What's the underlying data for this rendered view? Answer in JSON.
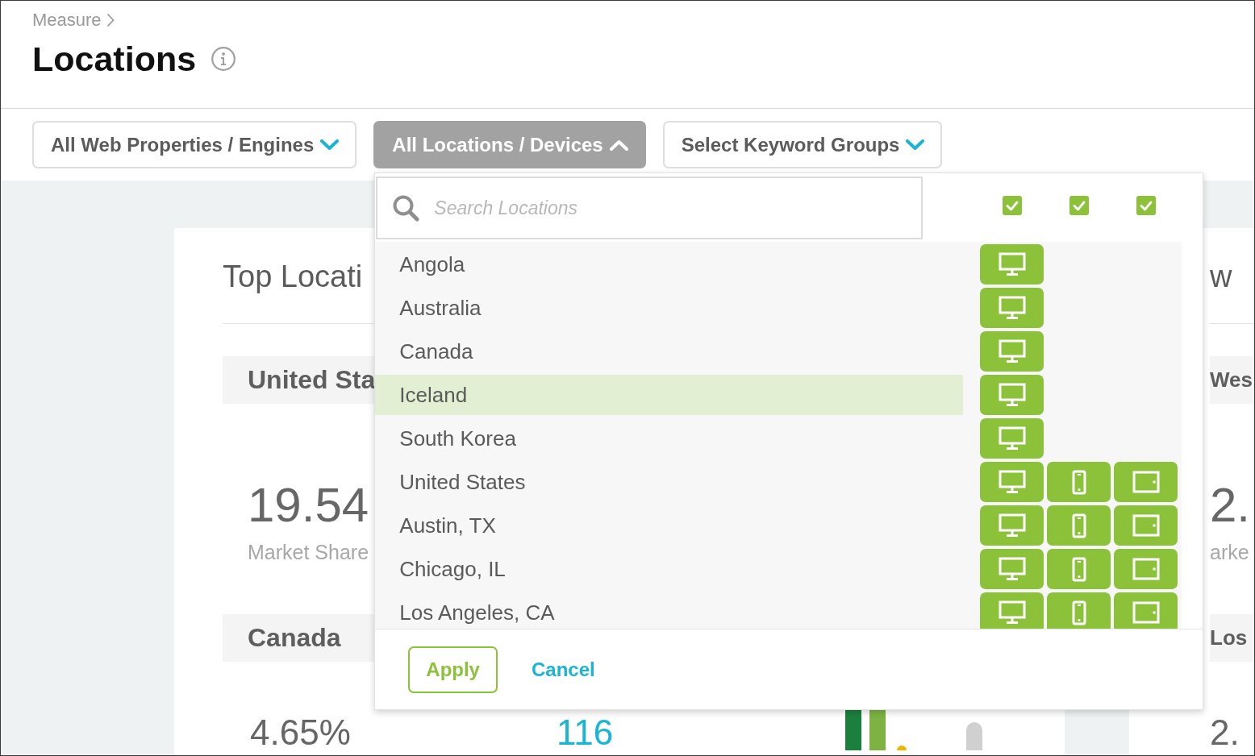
{
  "breadcrumb": {
    "label": "Measure"
  },
  "page": {
    "title": "Locations"
  },
  "filters": [
    {
      "label": "All Web Properties / Engines",
      "expanded": false
    },
    {
      "label": "All Locations / Devices",
      "expanded": true
    },
    {
      "label": "Select Keyword Groups",
      "expanded": false
    }
  ],
  "location_menu": {
    "search": {
      "placeholder": "Search Locations"
    },
    "device_columns": [
      {
        "checked": true
      },
      {
        "checked": true
      },
      {
        "checked": true
      }
    ],
    "locations": [
      {
        "name": "Angola",
        "selected": false,
        "devices": [
          {
            "kind": "desktop",
            "on": true
          }
        ]
      },
      {
        "name": "Australia",
        "selected": false,
        "devices": [
          {
            "kind": "desktop",
            "on": true
          }
        ]
      },
      {
        "name": "Canada",
        "selected": false,
        "devices": [
          {
            "kind": "desktop",
            "on": true
          }
        ]
      },
      {
        "name": "Iceland",
        "selected": true,
        "devices": [
          {
            "kind": "desktop",
            "on": true
          }
        ]
      },
      {
        "name": "South Korea",
        "selected": false,
        "devices": [
          {
            "kind": "desktop",
            "on": true
          }
        ]
      },
      {
        "name": "United States",
        "selected": false,
        "devices": [
          {
            "kind": "desktop",
            "on": true
          },
          {
            "kind": "mobile",
            "on": true
          },
          {
            "kind": "tablet",
            "on": true
          }
        ]
      },
      {
        "name": "Austin, TX",
        "selected": false,
        "devices": [
          {
            "kind": "desktop",
            "on": true
          },
          {
            "kind": "mobile",
            "on": true
          },
          {
            "kind": "tablet",
            "on": true
          }
        ]
      },
      {
        "name": "Chicago, IL",
        "selected": false,
        "devices": [
          {
            "kind": "desktop",
            "on": true
          },
          {
            "kind": "mobile",
            "on": true
          },
          {
            "kind": "tablet",
            "on": true
          }
        ]
      },
      {
        "name": "Los Angeles, CA",
        "selected": false,
        "devices": [
          {
            "kind": "desktop",
            "on": true
          },
          {
            "kind": "mobile",
            "on": true
          },
          {
            "kind": "tablet",
            "on": true
          }
        ]
      }
    ],
    "actions": [
      {
        "kind": "primary",
        "label": "Apply"
      },
      {
        "kind": "link",
        "label": "Cancel"
      }
    ]
  },
  "cards": [
    {
      "title": "Top Locati",
      "chart_preview": true,
      "sections": [
        {
          "heading": "United Sta",
          "value": "19.54",
          "caption": "Market Share"
        },
        {
          "heading": "Canada",
          "stats": [
            {
              "kind": "percent",
              "text": "4.65%"
            },
            {
              "kind": "link",
              "text": "116"
            }
          ]
        }
      ]
    },
    {
      "title": "w",
      "sections": [
        {
          "heading": "Wes",
          "value": "2.",
          "caption": "arke"
        },
        {
          "heading": "Los",
          "stats": [
            {
              "kind": "percent",
              "text": "2."
            }
          ]
        }
      ]
    }
  ]
}
